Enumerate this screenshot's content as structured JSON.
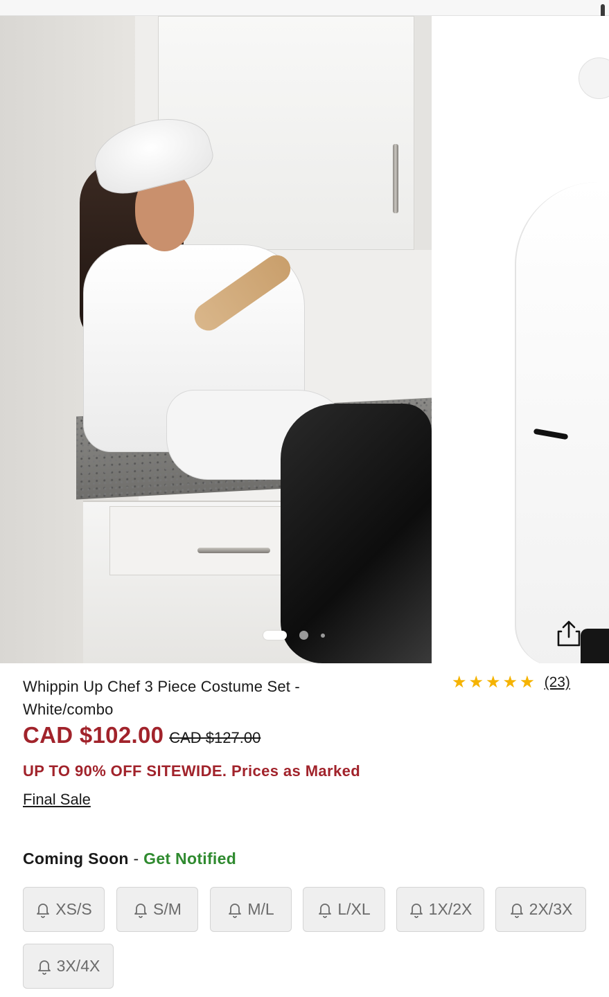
{
  "product": {
    "title": "Whippin Up Chef 3 Piece Costume Set - White/combo",
    "rating": 4.5,
    "review_count": "(23)",
    "price_now": "CAD $102.00",
    "price_was": "CAD $127.00",
    "promo": "UP TO 90% OFF SITEWIDE. Prices as Marked",
    "final_sale": "Final Sale"
  },
  "carousel": {
    "slide_count": 3,
    "active_index": 0,
    "share_icon": "share-icon"
  },
  "availability": {
    "status": "Coming Soon",
    "separator": " - ",
    "notify_label": "Get Notified"
  },
  "sizes": [
    {
      "label": "XS/S"
    },
    {
      "label": "S/M"
    },
    {
      "label": "M/L"
    },
    {
      "label": "L/XL"
    },
    {
      "label": "1X/2X"
    },
    {
      "label": "2X/3X"
    },
    {
      "label": "3X/4X"
    }
  ],
  "colors": {
    "price": "#a1232b",
    "notify": "#2f8a2f",
    "star": "#f5b301"
  }
}
